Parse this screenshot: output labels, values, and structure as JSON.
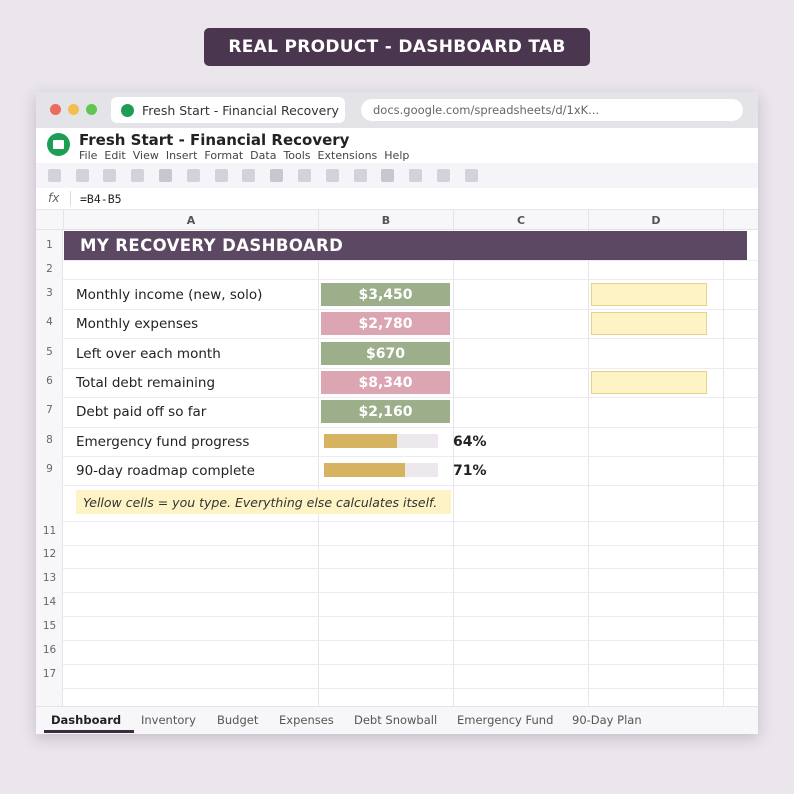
{
  "banner": "REAL PRODUCT - DASHBOARD TAB",
  "browser": {
    "tab_title": "Fresh Start - Financial Recovery",
    "url": "docs.google.com/spreadsheets/d/1xK..."
  },
  "doc": {
    "title": "Fresh Start - Financial Recovery",
    "menus": [
      "File",
      "Edit",
      "View",
      "Insert",
      "Format",
      "Data",
      "Tools",
      "Extensions",
      "Help"
    ]
  },
  "formula_bar": {
    "fx_label": "fx",
    "value": "=B4-B5"
  },
  "columns": [
    "A",
    "B",
    "C",
    "D"
  ],
  "rows": [
    "1",
    "2",
    "3",
    "4",
    "5",
    "6",
    "7",
    "8",
    "9",
    "11",
    "12",
    "13",
    "14",
    "15",
    "16",
    "17"
  ],
  "dashboard": {
    "header": "MY RECOVERY DASHBOARD",
    "items": [
      {
        "label": "Monthly income (new, solo)",
        "value": "$3,450",
        "color": "green",
        "input": true
      },
      {
        "label": "Monthly expenses",
        "value": "$2,780",
        "color": "pink",
        "input": true
      },
      {
        "label": "Left over each month",
        "value": "$670",
        "color": "green",
        "input": false
      },
      {
        "label": "Total debt remaining",
        "value": "$8,340",
        "color": "pink",
        "input": true
      },
      {
        "label": "Debt paid off so far",
        "value": "$2,160",
        "color": "green",
        "input": false
      }
    ],
    "progress": [
      {
        "label": "Emergency fund progress",
        "percent": "64%",
        "fraction": 0.64
      },
      {
        "label": "90-day roadmap complete",
        "percent": "71%",
        "fraction": 0.71
      }
    ],
    "note": "Yellow cells = you type. Everything else calculates itself."
  },
  "colors": {
    "value_green": "#9cae8a",
    "value_pink": "#dba6b1",
    "input_yellow": "#fdf3c4",
    "progress_gold": "#d6b360",
    "header_purple": "#5c4862"
  },
  "sheet_tabs": [
    "Dashboard",
    "Inventory",
    "Budget",
    "Expenses",
    "Debt Snowball",
    "Emergency Fund",
    "90-Day Plan"
  ],
  "active_sheet_tab": "Dashboard"
}
